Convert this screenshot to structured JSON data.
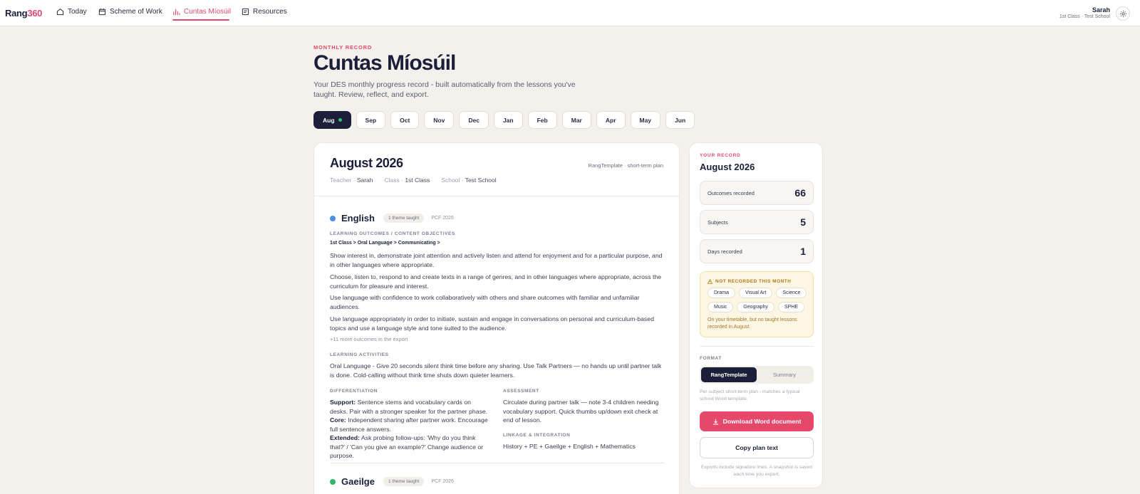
{
  "nav": {
    "logo_main": "Rang",
    "logo_accent": "360",
    "items": [
      {
        "label": "Today",
        "icon": "home-icon"
      },
      {
        "label": "Scheme of Work",
        "icon": "calendar-icon"
      },
      {
        "label": "Cuntas Míosúil",
        "icon": "bar-chart-icon",
        "active": true
      },
      {
        "label": "Resources",
        "icon": "document-icon"
      }
    ],
    "user_name": "Sarah",
    "user_sub": "1st Class · Test School"
  },
  "header": {
    "eyebrow": "MONTHLY RECORD",
    "title": "Cuntas Míosúil",
    "subtitle": "Your DES monthly progress record - built automatically from the lessons you've taught. Review, reflect, and export."
  },
  "months": [
    "Aug",
    "Sep",
    "Oct",
    "Nov",
    "Dec",
    "Jan",
    "Feb",
    "Mar",
    "Apr",
    "May",
    "Jun"
  ],
  "active_month": "Aug",
  "record": {
    "title": "August 2026",
    "template_label": "RangTemplate · short-term plan",
    "teacher_label": "Teacher ·",
    "teacher": "Sarah",
    "class_label": "Class ·",
    "class": "1st Class",
    "school_label": "School ·",
    "school": "Test School"
  },
  "english": {
    "name": "English",
    "color": "#4a8fe0",
    "pill": "1 theme taught",
    "pcf": "PCF 2026",
    "outcomes_label": "LEARNING OUTCOMES / CONTENT OBJECTIVES",
    "path": "1st Class > Oral Language > Communicating >",
    "outcomes": [
      "Show interest in, demonstrate joint attention and actively listen and attend for enjoyment and for a particular purpose, and in other languages where appropriate.",
      "Choose, listen to, respond to and create texts in a range of genres, and in other languages where appropriate, across the curriculum for pleasure and interest.",
      "Use language with confidence to work collaboratively with others and share outcomes with familiar and unfamiliar audiences.",
      "Use language appropriately in order to initiate, sustain and engage in conversations on personal and curriculum-based topics and use a language style and tone suited to the audience."
    ],
    "more": "+11 more outcomes in the export",
    "activities_label": "LEARNING ACTIVITIES",
    "activities": "Oral Language - Give 20 seconds silent think time before any sharing. Use Talk Partners — no hands up until partner talk is done. Cold-calling without think time shuts down quieter learners.",
    "diff_label": "DIFFERENTIATION",
    "support_label": "Support:",
    "support": " Sentence stems and vocabulary cards on desks. Pair with a stronger speaker for the partner phase.",
    "core_label": "Core:",
    "core": " Independent sharing after partner work. Encourage full sentence answers.",
    "extended_label": "Extended:",
    "extended": " Ask probing follow-ups: 'Why do you think that?' / 'Can you give an example?' Change audience or purpose.",
    "assess_label": "ASSESSMENT",
    "assessment": "Circulate during partner talk — note 3-4 children needing vocabulary support. Quick thumbs up/down exit check at end of lesson.",
    "linkage_label": "LINKAGE & INTEGRATION",
    "linkage": "History + PE + Gaeilge + English + Mathematics"
  },
  "gaeilge": {
    "name": "Gaeilge",
    "color": "#2fb56a",
    "pill": "1 theme taught",
    "pcf": "PCF 2026"
  },
  "side": {
    "eyebrow": "YOUR RECORD",
    "title": "August 2026",
    "stats": [
      {
        "label": "Outcomes recorded",
        "value": "66"
      },
      {
        "label": "Subjects",
        "value": "5"
      },
      {
        "label": "Days recorded",
        "value": "1"
      }
    ],
    "warn_title": "NOT RECORDED THIS MONTH",
    "missing": [
      "Drama",
      "Visual Art",
      "Science",
      "Music",
      "Geography",
      "SPHE"
    ],
    "warn_note": "On your timetable, but no taught lessons recorded in August.",
    "format_label": "FORMAT",
    "format_options": [
      "RangTemplate",
      "Summary"
    ],
    "format_note": "Per-subject short-term plan - matches a typical school Word template.",
    "download": "Download Word document",
    "copy": "Copy plan text",
    "foot": "Exports include signature lines. A snapshot is saved each time you export."
  }
}
